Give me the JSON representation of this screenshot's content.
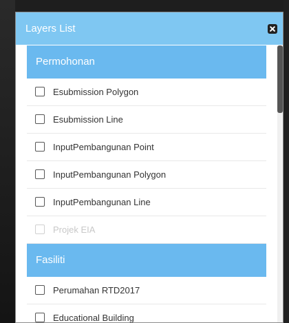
{
  "panel": {
    "title": "Layers List",
    "close_icon": "close-icon"
  },
  "groups": [
    {
      "title": "Permohonan",
      "items": [
        {
          "label": "Esubmission Polygon",
          "disabled": false,
          "checked": false
        },
        {
          "label": "Esubmission Line",
          "disabled": false,
          "checked": false
        },
        {
          "label": "InputPembangunan Point",
          "disabled": false,
          "checked": false
        },
        {
          "label": "InputPembangunan Polygon",
          "disabled": false,
          "checked": false
        },
        {
          "label": "InputPembangunan Line",
          "disabled": false,
          "checked": false
        },
        {
          "label": "Projek EIA",
          "disabled": true,
          "checked": false
        }
      ]
    },
    {
      "title": "Fasiliti",
      "items": [
        {
          "label": "Perumahan RTD2017",
          "disabled": false,
          "checked": false
        },
        {
          "label": "Educational Building",
          "disabled": false,
          "checked": false
        }
      ]
    }
  ],
  "colors": {
    "header": "#7fc7f2",
    "group_header": "#6ab9ef",
    "disabled_text": "#c8c8c8"
  }
}
